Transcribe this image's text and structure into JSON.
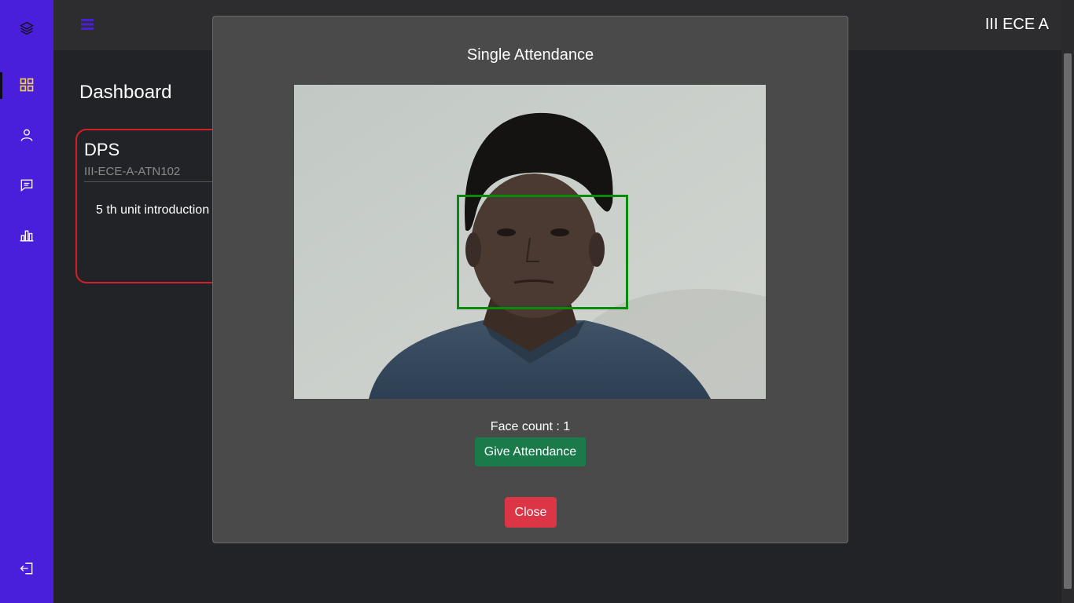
{
  "header": {
    "class_label": "III ECE A"
  },
  "page": {
    "title": "Dashboard"
  },
  "card": {
    "code": "DPS",
    "subject_id": "III-ECE-A-ATN102",
    "topic": "5 th unit introduction"
  },
  "modal": {
    "title": "Single Attendance",
    "face_count": "Face count : 1",
    "give_label": "Give Attendance",
    "close_label": "Close"
  },
  "sidebar": {
    "items": [
      {
        "icon": "layers-icon"
      },
      {
        "icon": "dashboard-grid-icon",
        "active": true
      },
      {
        "icon": "user-icon"
      },
      {
        "icon": "message-icon"
      },
      {
        "icon": "bar-chart-icon"
      },
      {
        "icon": "logout-icon"
      }
    ]
  },
  "colors": {
    "sidebar": "#4a1fdc",
    "active_icon": "#f0d24a",
    "card_border": "#d41f26",
    "give_button": "#1b7a4a",
    "close_button": "#dc3545",
    "face_box": "#0a8a0a"
  }
}
